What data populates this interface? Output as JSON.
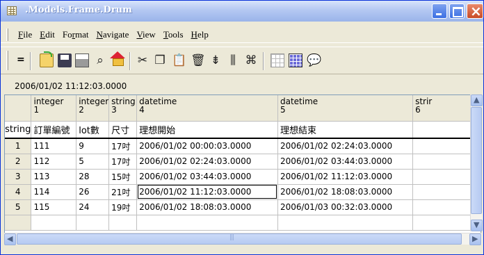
{
  "window": {
    "title": ".Models.Frame.Drum"
  },
  "menu": [
    {
      "u": "F",
      "rest": "ile"
    },
    {
      "u": "E",
      "rest": "dit"
    },
    {
      "pre": "Fo",
      "u": "r",
      "rest": "mat"
    },
    {
      "u": "N",
      "rest": "avigate"
    },
    {
      "u": "V",
      "rest": "iew"
    },
    {
      "u": "T",
      "rest": "ools"
    },
    {
      "u": "H",
      "rest": "elp"
    }
  ],
  "toolbar": {
    "eq_label": "="
  },
  "address": "2006/01/02 11:12:03.0000",
  "grid": {
    "row_header_label": "string",
    "columns": [
      {
        "type": "integer",
        "index": "1",
        "name": "訂單編號"
      },
      {
        "type": "integer",
        "index": "2",
        "name": "lot數"
      },
      {
        "type": "string",
        "index": "3",
        "name": "尺寸"
      },
      {
        "type": "datetime",
        "index": "4",
        "name": "理想開始"
      },
      {
        "type": "datetime",
        "index": "5",
        "name": "理想結束"
      },
      {
        "type": "strir",
        "index": "6",
        "name": ""
      }
    ],
    "rows": [
      {
        "num": "1",
        "cells": [
          "111",
          "9",
          "17吋",
          "2006/01/02 00:00:03.0000",
          "2006/01/02 02:24:03.0000",
          ""
        ]
      },
      {
        "num": "2",
        "cells": [
          "112",
          "5",
          "17吋",
          "2006/01/02 02:24:03.0000",
          "2006/01/02 03:44:03.0000",
          ""
        ]
      },
      {
        "num": "3",
        "cells": [
          "113",
          "28",
          "15吋",
          "2006/01/02 03:44:03.0000",
          "2006/01/02 11:12:03.0000",
          ""
        ]
      },
      {
        "num": "4",
        "cells": [
          "114",
          "26",
          "21吋",
          "2006/01/02 11:12:03.0000",
          "2006/01/02 18:08:03.0000",
          ""
        ]
      },
      {
        "num": "5",
        "cells": [
          "115",
          "24",
          "19吋",
          "2006/01/02 18:08:03.0000",
          "2006/01/03 00:32:03.0000",
          ""
        ]
      }
    ]
  }
}
